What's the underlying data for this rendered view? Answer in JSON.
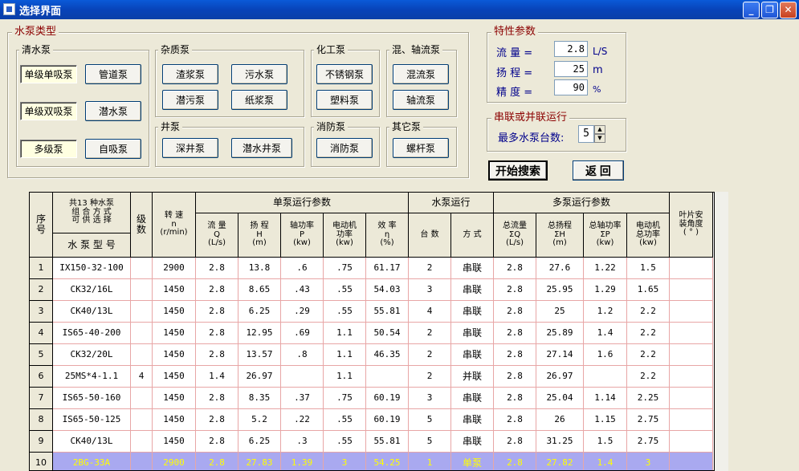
{
  "window": {
    "title": "选择界面"
  },
  "pump_types": {
    "title": "水泵类型",
    "clear": {
      "title": "清水泵",
      "items": [
        "单级单吸泵",
        "单级双吸泵",
        "多级泵"
      ],
      "buttons": [
        "管道泵",
        "潜水泵",
        "自吸泵"
      ]
    },
    "impurity": {
      "title": "杂质泵",
      "buttons": [
        "渣浆泵",
        "污水泵",
        "潜污泵",
        "纸浆泵"
      ]
    },
    "chemical": {
      "title": "化工泵",
      "buttons": [
        "不锈钢泵",
        "塑料泵"
      ]
    },
    "mixed": {
      "title": "混、轴流泵",
      "buttons": [
        "混流泵",
        "轴流泵"
      ]
    },
    "well": {
      "title": "井泵",
      "buttons": [
        "深井泵",
        "潜水井泵"
      ]
    },
    "fire": {
      "title": "消防泵",
      "buttons": [
        "消防泵"
      ]
    },
    "other": {
      "title": "其它泵",
      "buttons": [
        "螺杆泵"
      ]
    }
  },
  "params": {
    "title": "特性参数",
    "flow": {
      "label": "流  量 =",
      "value": "2.8",
      "unit": "L/S"
    },
    "head": {
      "label": "扬  程 =",
      "value": "25",
      "unit": "m"
    },
    "precision": {
      "label": "精  度 =",
      "value": "90",
      "unit": "%"
    }
  },
  "series": {
    "title": "串联或并联运行",
    "label": "最多水泵台数:",
    "value": "5"
  },
  "actions": {
    "search": "开始搜索",
    "back": "返  回"
  },
  "table": {
    "h_seq": [
      "序",
      "号"
    ],
    "h_combo": "共13 种水泵\n组 合 方 式\n可 供 选 择",
    "h_model": "水 泵 型 号",
    "h_stage": [
      "级",
      "数"
    ],
    "h_speed": [
      "转  速",
      "n",
      "(r/min)"
    ],
    "h_single": "单泵运行参数",
    "h_run": "水泵运行",
    "h_multi": "多泵运行参数",
    "h_blade": [
      "叶片安",
      "装角度",
      "( ° )"
    ],
    "sub": [
      [
        "流  量",
        "Q",
        "(L/s)"
      ],
      [
        "扬  程",
        "H",
        "(m)"
      ],
      [
        "轴功率",
        "P",
        "(kw)"
      ],
      [
        "电动机",
        "功率",
        "(kw)"
      ],
      [
        "效  率",
        "η",
        "(%)"
      ],
      [
        "台  数"
      ],
      [
        "方  式"
      ],
      [
        "总流量",
        "ΣQ",
        "(L/s)"
      ],
      [
        "总扬程",
        "ΣH",
        "(m)"
      ],
      [
        "总轴功率",
        "ΣP",
        "(kw)"
      ],
      [
        "电动机",
        "总功率",
        "(kw)"
      ]
    ],
    "rows": [
      [
        "1",
        "IX150-32-100",
        "",
        "2900",
        "2.8",
        "13.8",
        ".6",
        ".75",
        "61.17",
        "2",
        "串联",
        "2.8",
        "27.6",
        "1.22",
        "1.5",
        ""
      ],
      [
        "2",
        "CK32/16L",
        "",
        "1450",
        "2.8",
        "8.65",
        ".43",
        ".55",
        "54.03",
        "3",
        "串联",
        "2.8",
        "25.95",
        "1.29",
        "1.65",
        ""
      ],
      [
        "3",
        "CK40/13L",
        "",
        "1450",
        "2.8",
        "6.25",
        ".29",
        ".55",
        "55.81",
        "4",
        "串联",
        "2.8",
        "25",
        "1.2",
        "2.2",
        ""
      ],
      [
        "4",
        "IS65-40-200",
        "",
        "1450",
        "2.8",
        "12.95",
        ".69",
        "1.1",
        "50.54",
        "2",
        "串联",
        "2.8",
        "25.89",
        "1.4",
        "2.2",
        ""
      ],
      [
        "5",
        "CK32/20L",
        "",
        "1450",
        "2.8",
        "13.57",
        ".8",
        "1.1",
        "46.35",
        "2",
        "串联",
        "2.8",
        "27.14",
        "1.6",
        "2.2",
        ""
      ],
      [
        "6",
        "25MS*4-1.1",
        "4",
        "1450",
        "1.4",
        "26.97",
        "",
        "1.1",
        "",
        "2",
        "并联",
        "2.8",
        "26.97",
        "",
        "2.2",
        ""
      ],
      [
        "7",
        "IS65-50-160",
        "",
        "1450",
        "2.8",
        "8.35",
        ".37",
        ".75",
        "60.19",
        "3",
        "串联",
        "2.8",
        "25.04",
        "1.14",
        "2.25",
        ""
      ],
      [
        "8",
        "IS65-50-125",
        "",
        "1450",
        "2.8",
        "5.2",
        ".22",
        ".55",
        "60.19",
        "5",
        "串联",
        "2.8",
        "26",
        "1.15",
        "2.75",
        ""
      ],
      [
        "9",
        "CK40/13L",
        "",
        "1450",
        "2.8",
        "6.25",
        ".3",
        ".55",
        "55.81",
        "5",
        "串联",
        "2.8",
        "31.25",
        "1.5",
        "2.75",
        ""
      ],
      [
        "10",
        "2BG-33A",
        "",
        "2900",
        "2.8",
        "27.83",
        "1.39",
        "3",
        "54.25",
        "1",
        "单泵",
        "2.8",
        "27.82",
        "1.4",
        "3",
        ""
      ]
    ],
    "selected_row": 9,
    "colors": {
      "grid_line": "#e8a6a6",
      "selected_bg": "#a9a9f0",
      "selected_fg": "#ffff00"
    }
  }
}
